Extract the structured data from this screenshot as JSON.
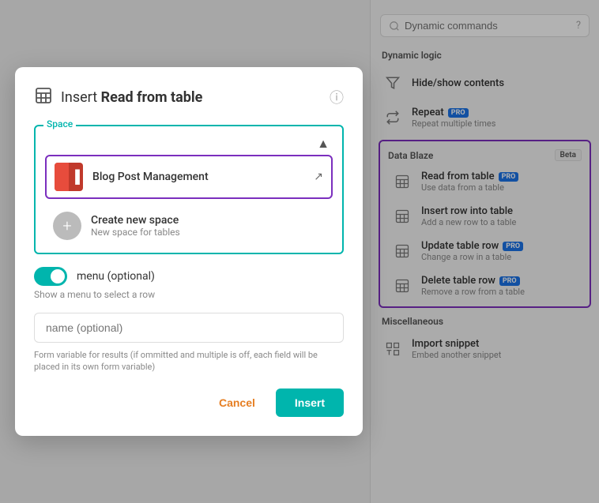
{
  "modal": {
    "title_prefix": "Insert ",
    "title_bold": "Read from table",
    "info_icon": "ⓘ",
    "space_label": "Space",
    "selected_space": {
      "name": "Blog Post Management",
      "external_link": "↗"
    },
    "create_space": {
      "title": "Create new space",
      "desc": "New space for tables"
    },
    "menu_toggle": {
      "label": "menu (optional)",
      "desc": "Show a menu to select a row"
    },
    "name_input": {
      "placeholder": "name (optional)",
      "desc": "Form variable for results (if ommitted and multiple is off, each field will be placed in its own form variable)"
    },
    "cancel_label": "Cancel",
    "insert_label": "Insert"
  },
  "right_panel": {
    "search_placeholder": "Dynamic commands",
    "help_icon": "?",
    "sections": {
      "dynamic_logic": {
        "label": "Dynamic logic",
        "items": [
          {
            "title": "Hide/show contents",
            "desc": "",
            "icon": "filter"
          },
          {
            "title": "Repeat",
            "desc": "Repeat multiple times",
            "icon": "repeat",
            "badge": "PRO"
          }
        ]
      },
      "data_blaze": {
        "label": "Data Blaze",
        "badge": "Beta",
        "items": [
          {
            "title": "Read from table",
            "desc": "Use data from a table",
            "icon": "table",
            "badge": "PRO"
          },
          {
            "title": "Insert row into table",
            "desc": "Add a new row to a table",
            "icon": "table"
          },
          {
            "title": "Update table row",
            "desc": "Change a row in a table",
            "icon": "table",
            "badge": "PRO"
          },
          {
            "title": "Delete table row",
            "desc": "Remove a row from a table",
            "icon": "table",
            "badge": "PRO"
          }
        ]
      },
      "miscellaneous": {
        "label": "Miscellaneous",
        "items": [
          {
            "title": "Import snippet",
            "desc": "Embed another snippet",
            "icon": "import"
          }
        ]
      }
    }
  }
}
